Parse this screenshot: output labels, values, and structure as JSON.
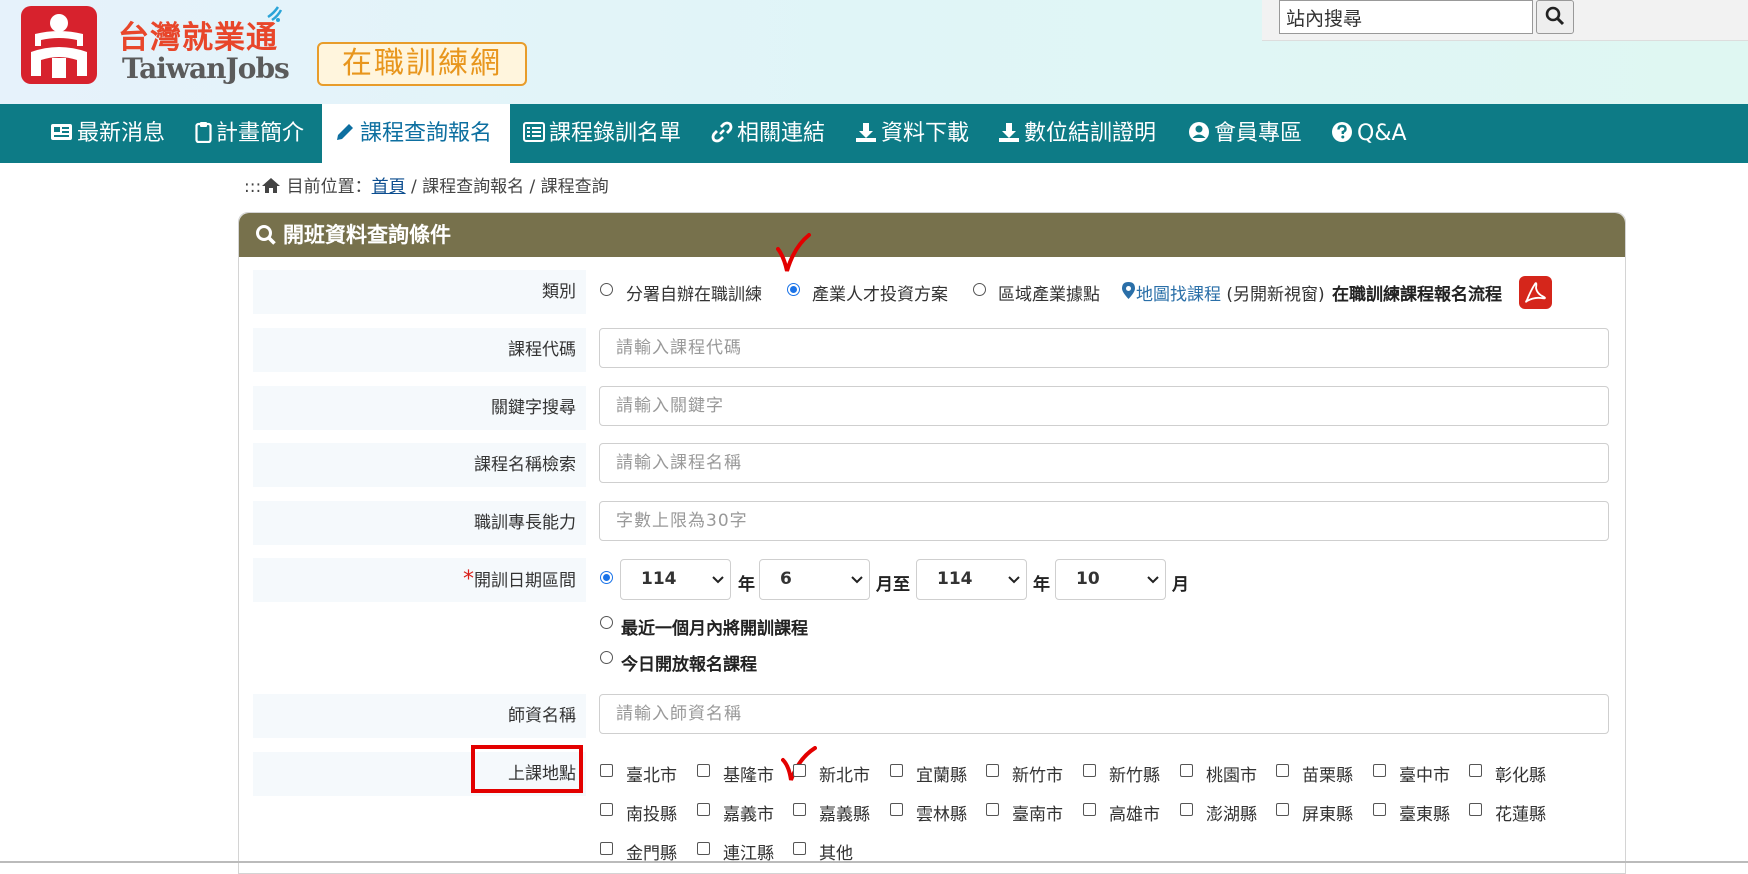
{
  "header": {
    "logo_zh": "台灣就業通",
    "logo_en": "TaiwanJobs",
    "site_badge": "在職訓練網",
    "search": {
      "value": "站內搜尋"
    }
  },
  "nav": {
    "items": [
      {
        "label": "最新消息",
        "icon": "newspaper-icon"
      },
      {
        "label": "計畫簡介",
        "icon": "clipboard-icon"
      },
      {
        "label": "課程查詢報名",
        "icon": "pencil-icon",
        "active": true
      },
      {
        "label": "課程錄訓名單",
        "icon": "list-icon"
      },
      {
        "label": "相關連結",
        "icon": "link-icon"
      },
      {
        "label": "資料下載",
        "icon": "download-icon"
      },
      {
        "label": "數位結訓證明",
        "icon": "download-icon"
      },
      {
        "label": "會員專區",
        "icon": "user-circle-icon"
      },
      {
        "label": "Q&A",
        "icon": "question-circle-icon"
      }
    ]
  },
  "breadcrumb": {
    "prefix": ":::",
    "label": "目前位置：",
    "home": "首頁",
    "rest": " / 課程查詢報名 / 課程查詢"
  },
  "panel": {
    "title": "開班資料查詢條件",
    "category": {
      "label": "類別",
      "options": [
        "分署自辦在職訓練",
        "產業人才投資方案",
        "區域產業據點"
      ],
      "selected": "產業人才投資方案",
      "map_link": "地圖找課程",
      "map_note": " (另開新視窗)",
      "flow_text": "在職訓練課程報名流程"
    },
    "course_code": {
      "label": "課程代碼",
      "placeholder": "請輸入課程代碼"
    },
    "keyword": {
      "label": "關鍵字搜尋",
      "placeholder": "請輸入關鍵字"
    },
    "course_name": {
      "label": "課程名稱檢索",
      "placeholder": "請輸入課程名稱"
    },
    "skill": {
      "label": "職訓專長能力",
      "placeholder": "字數上限為30字"
    },
    "date_range": {
      "required_mark": "*",
      "label": "開訓日期區間",
      "from_year": "114",
      "year_unit": "年",
      "from_month": "6",
      "to_text": "月至",
      "to_year": "114",
      "to_month": "10",
      "month_unit": "月",
      "option_recent": "最近一個月內將開訓課程",
      "option_today": "今日開放報名課程"
    },
    "teacher": {
      "label": "師資名稱",
      "placeholder": "請輸入師資名稱"
    },
    "location": {
      "label": "上課地點",
      "cities": [
        "臺北市",
        "基隆市",
        "新北市",
        "宜蘭縣",
        "新竹市",
        "新竹縣",
        "桃園市",
        "苗栗縣",
        "臺中市",
        "彰化縣",
        "南投縣",
        "嘉義市",
        "嘉義縣",
        "雲林縣",
        "臺南市",
        "高雄市",
        "澎湖縣",
        "屏東縣",
        "臺東縣",
        "花蓮縣",
        "金門縣",
        "連江縣",
        "其他"
      ]
    }
  },
  "colors": {
    "nav_bg": "#0d7b86",
    "panel_head": "#77714c",
    "annotation_red": "#e30000",
    "radio_blue": "#1a73e8"
  }
}
